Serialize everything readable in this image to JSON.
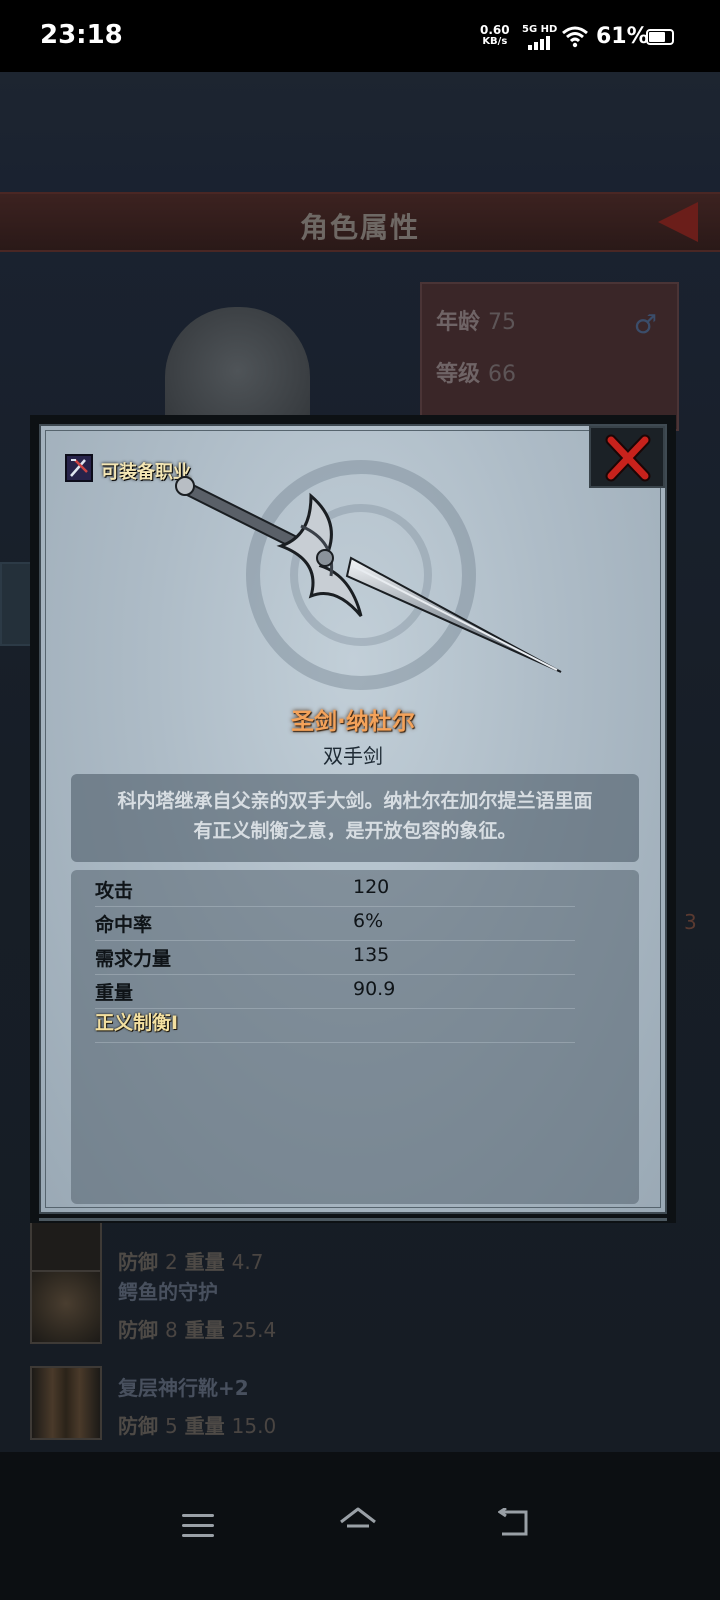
{
  "status_bar": {
    "time": "23:18",
    "net_speed_value": "0.60",
    "net_speed_unit": "KB/s",
    "network": "5G HD",
    "battery": "61%"
  },
  "background": {
    "header_title": "角色属性",
    "stats": {
      "age_label": "年龄",
      "age_value": "75",
      "level_label": "等级",
      "level_value": "66"
    },
    "side_number": "3",
    "items": [
      {
        "name": "",
        "defense_label": "防御",
        "defense_value": "2",
        "weight_label": "重量",
        "weight_value": "4.7"
      },
      {
        "name": "鳄鱼的守护",
        "defense_label": "防御",
        "defense_value": "8",
        "weight_label": "重量",
        "weight_value": "25.4"
      },
      {
        "name": "复层神行靴+2",
        "defense_label": "防御",
        "defense_value": "5",
        "weight_label": "重量",
        "weight_value": "15.0"
      }
    ]
  },
  "modal": {
    "class_label": "可装备职业",
    "item_name": "圣剑·纳杜尔",
    "item_type": "双手剑",
    "description_line1": "科内塔继承自父亲的双手大剑。纳杜尔在加尔提兰语里面",
    "description_line2": "有正义制衡之意，是开放包容的象征。",
    "stats": [
      {
        "label": "攻击",
        "value": "120"
      },
      {
        "label": "命中率",
        "value": "6%"
      },
      {
        "label": "需求力量",
        "value": "135"
      },
      {
        "label": "重量",
        "value": "90.9"
      }
    ],
    "special": "正义制衡I"
  },
  "colors": {
    "item_name": "#f3a25a",
    "special": "#f3e0a0",
    "close_x": "#c8221c"
  },
  "icons": [
    "back-arrow-icon",
    "male-icon",
    "class-icon",
    "close-icon",
    "menu-icon",
    "home-icon",
    "back-icon"
  ]
}
